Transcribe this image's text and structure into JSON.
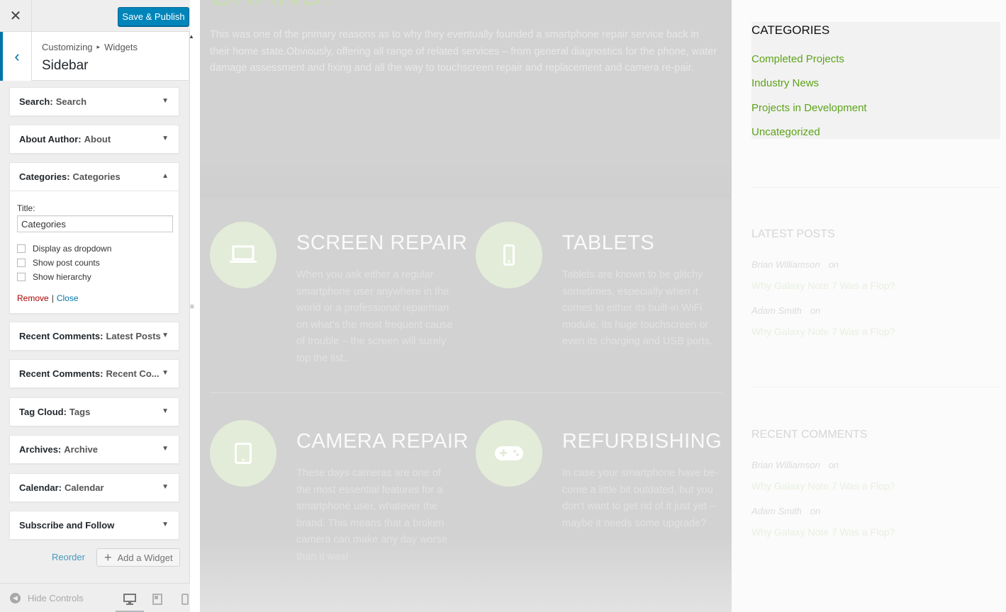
{
  "header": {
    "close_glyph": "✕",
    "save_label": "Save & Publish"
  },
  "section": {
    "back_glyph": "‹",
    "crumb_root": "Customizing",
    "crumb_sep": "▸",
    "crumb_child": "Widgets",
    "title": "Sidebar"
  },
  "widgets": [
    {
      "type": "Search:",
      "title": "Search",
      "arrow": "▼"
    },
    {
      "type": "About Author:",
      "title": "About",
      "arrow": "▼"
    },
    {
      "type": "Categories:",
      "title": "Categories",
      "arrow": "▲"
    },
    {
      "type": "Recent Comments:",
      "title": "Latest Posts",
      "arrow": "▼"
    },
    {
      "type": "Recent Comments:",
      "title": "Recent Co...",
      "arrow": "▼"
    },
    {
      "type": "Tag Cloud:",
      "title": "Tags",
      "arrow": "▼"
    },
    {
      "type": "Archives:",
      "title": "Archive",
      "arrow": "▼"
    },
    {
      "type": "Calendar:",
      "title": "Calendar",
      "arrow": "▼"
    },
    {
      "type": "Subscribe and Follow",
      "title": "",
      "arrow": "▼"
    }
  ],
  "categories_form": {
    "title_label": "Title:",
    "title_value": "Categories",
    "options": [
      {
        "label": "Display as dropdown",
        "checked": false
      },
      {
        "label": "Show post counts",
        "checked": false
      },
      {
        "label": "Show hierarchy",
        "checked": false
      }
    ],
    "remove_label": "Remove",
    "separator": "|",
    "close_label": "Close"
  },
  "actions": {
    "reorder_label": "Reorder",
    "add_widget_label": "Add a Widget",
    "add_glyph": "+"
  },
  "footer": {
    "hide_controls_label": "Hide Controls",
    "hide_glyph": "◀"
  },
  "preview": {
    "brand_heading": "BRAND.",
    "intro": "This was one of the primary reasons as to why they eventually founded a smartphone repair service back in their home state.Obviously, offering all range of related services – from general diagnostics for the phone, water damage assessment and fixing and all the way to touchscreen repair and replacement and camera re-pair.",
    "services": [
      {
        "title": "SCREEN REPAIR",
        "icon": "laptop-icon",
        "text": "When you ask either a regular smartphone user anywhere in the world or a professional repairman on what’s the most frequent cause of trouble – the screen will surely top the list.."
      },
      {
        "title": "TABLETS",
        "icon": "phone-icon",
        "text": "Tablets are known to be glitchy sometimes, especially when it comes to either its built-in WiFi module, its huge touchscreen or even its charging and USB ports."
      },
      {
        "title": "CAMERA REPAIR",
        "icon": "tablet-icon",
        "text": "These days cameras are one of the most essential features for a smartphone user, whatever the brand. This means that a broken camera can make any day worse than it was!"
      },
      {
        "title": "REFURBISHING",
        "icon": "gamepad-icon",
        "text": "In case your smartphone have be-come a little bit outdated, but you don’t want to get rid of it just yet – maybe it needs some upgrade?"
      }
    ],
    "sidebar": {
      "top_fragment": "...",
      "categories_title": "CATEGORIES",
      "categories": [
        "Completed Projects",
        "Industry News",
        "Projects in Development",
        "Uncategorized"
      ],
      "latest_posts_title": "LATEST POSTS",
      "latest_posts": [
        {
          "author": "Brian Williamson",
          "on": "on",
          "post": "Why Galaxy Note 7 Was a Flop?"
        },
        {
          "author": "Adam Smith",
          "on": "on",
          "post": "Why Galaxy Note 7 Was a Flop?"
        }
      ],
      "recent_comments_title": "RECENT COMMENTS",
      "recent_comments": [
        {
          "author": "Brian Williamson",
          "on": "on",
          "post": "Why Galaxy Note 7 Was a Flop?"
        },
        {
          "author": "Adam Smith",
          "on": "on",
          "post": "Why Galaxy Note 7 Was a Flop?"
        }
      ]
    }
  },
  "colors": {
    "accent": "#0085ba",
    "link_green": "#5da31a",
    "icon_circle": "#e3ecd8"
  }
}
